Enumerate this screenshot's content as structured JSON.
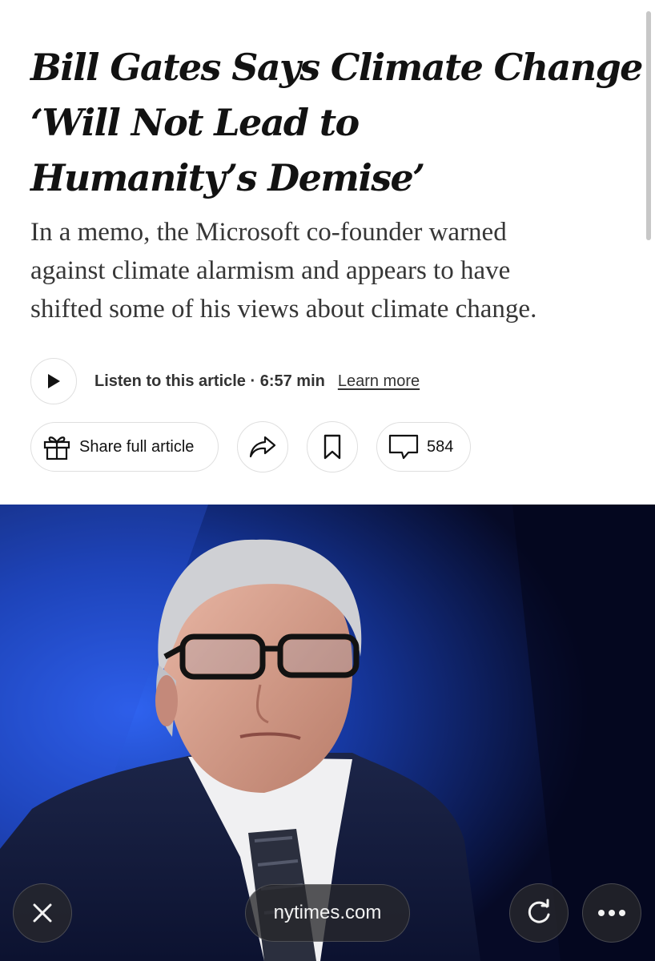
{
  "article": {
    "headline_lines": [
      "Bill Gates Says Climate Change",
      "‘Will Not Lead to",
      "Humanity’s Demise’"
    ],
    "summary_lines": [
      "In a memo, the Microsoft co-founder warned",
      "against climate alarmism and appears to have",
      "shifted some of his views about climate change."
    ]
  },
  "audio": {
    "listen_text": "Listen to this article · 6:57 min",
    "learn_more": "Learn more",
    "icon": "play-icon"
  },
  "actions": {
    "share_label": "Share full article",
    "share_icon": "gift-icon",
    "forward_icon": "share-arrow-icon",
    "bookmark_icon": "bookmark-icon",
    "comments_icon": "comment-icon",
    "comments_count": "584"
  },
  "browser_bar": {
    "url": "nytimes.com",
    "close_icon": "close-icon",
    "reload_icon": "reload-icon",
    "more_icon": "more-icon"
  },
  "colors": {
    "text": "#121212",
    "summary_text": "#363636",
    "border": "#dfdfdf",
    "photo_background": "#1b3fb8"
  }
}
